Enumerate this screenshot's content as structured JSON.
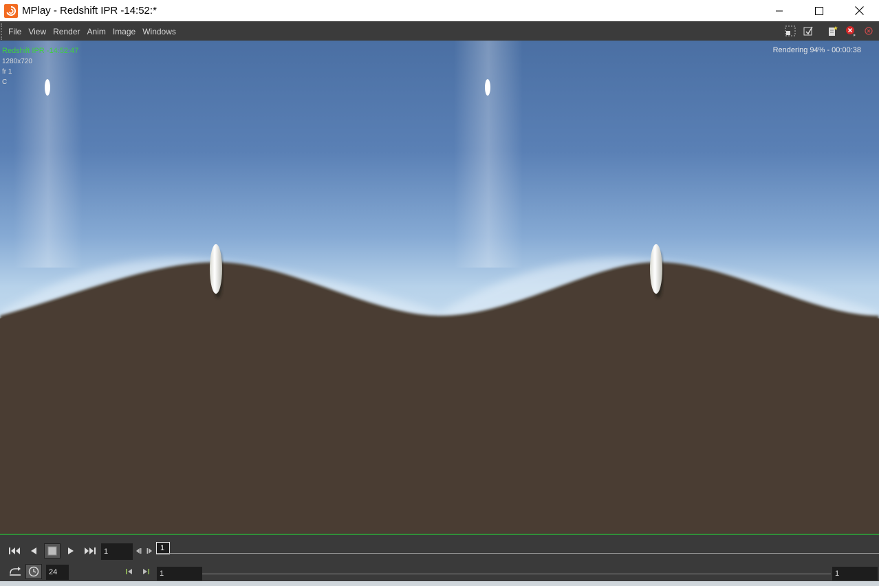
{
  "window": {
    "title": "MPlay - Redshift IPR -14:52:*",
    "controls": {
      "minimize": "minimize-icon",
      "maximize": "maximize-icon",
      "close": "close-icon"
    }
  },
  "menu": {
    "items": [
      "File",
      "View",
      "Render",
      "Anim",
      "Image",
      "Windows"
    ]
  },
  "toolbar": {
    "icons": [
      "region-select-icon",
      "snapshot-icon",
      "add-note-icon",
      "stop-render-icon",
      "cancel-render-icon"
    ]
  },
  "viewport": {
    "render_name": "Redshift IPR -14:52:47",
    "resolution": "1280x720",
    "frame_label": "fr 1",
    "channel": "C",
    "status": "Rendering 94% - 00:00:38",
    "colors": {
      "sky_top": "#4f73a6",
      "sky_horizon": "#b9d3ea",
      "ground": "#4a3d33",
      "status_green": "#3fd13f"
    }
  },
  "playbar": {
    "current_frame": "1",
    "fps": "24",
    "timeline_marker": "1",
    "range_start": "1",
    "range_end": "1",
    "buttons": [
      "first-frame-icon",
      "play-reverse-icon",
      "stop-icon",
      "play-forward-icon",
      "last-frame-icon",
      "step-back-icon",
      "step-forward-icon",
      "loop-mode-icon",
      "realtime-icon",
      "range-start-icon",
      "range-end-icon"
    ]
  }
}
